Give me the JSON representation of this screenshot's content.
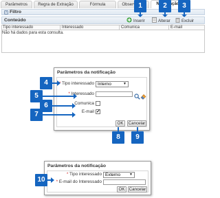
{
  "tabs": [
    {
      "label": "Parâmetros"
    },
    {
      "label": "Regra de Extração"
    },
    {
      "label": "Fórmula"
    },
    {
      "label": "Observação"
    },
    {
      "label": "Notificação"
    }
  ],
  "filter": {
    "label": "Filtro",
    "toggle_icon": "chevron-icon"
  },
  "content": {
    "title": "Conteúdo",
    "toolbar": {
      "insert": "Inserir",
      "edit": "Alterar",
      "delete": "Excluir"
    },
    "columns": [
      "Tipo interessado",
      "Interessado",
      "Comunica",
      "E-mail"
    ],
    "empty_message": "Não há dados para esta consulta."
  },
  "callouts": [
    "1",
    "2",
    "3",
    "4",
    "5",
    "6",
    "7",
    "8",
    "9",
    "10"
  ],
  "dialog1": {
    "title": "Parâmetros da notificação",
    "fields": {
      "tipo_label": "Tipo interessado",
      "tipo_value": "Interno",
      "interessado_label": "Interessado",
      "interessado_value": "",
      "comunica_label": "Comunica",
      "comunica_checked": false,
      "email_label": "E-mail",
      "email_checked": true
    },
    "ok": "OK",
    "cancel": "Cancelar"
  },
  "dialog2": {
    "title": "Parâmetros da notificação",
    "fields": {
      "tipo_label": "Tipo interessado",
      "tipo_value": "Externo",
      "email_label": "E-mail do Interessado",
      "email_value": ""
    },
    "ok": "OK",
    "cancel": "Cancelar"
  },
  "colors": {
    "callout": "#1565c0",
    "required": "#d32f2f"
  }
}
